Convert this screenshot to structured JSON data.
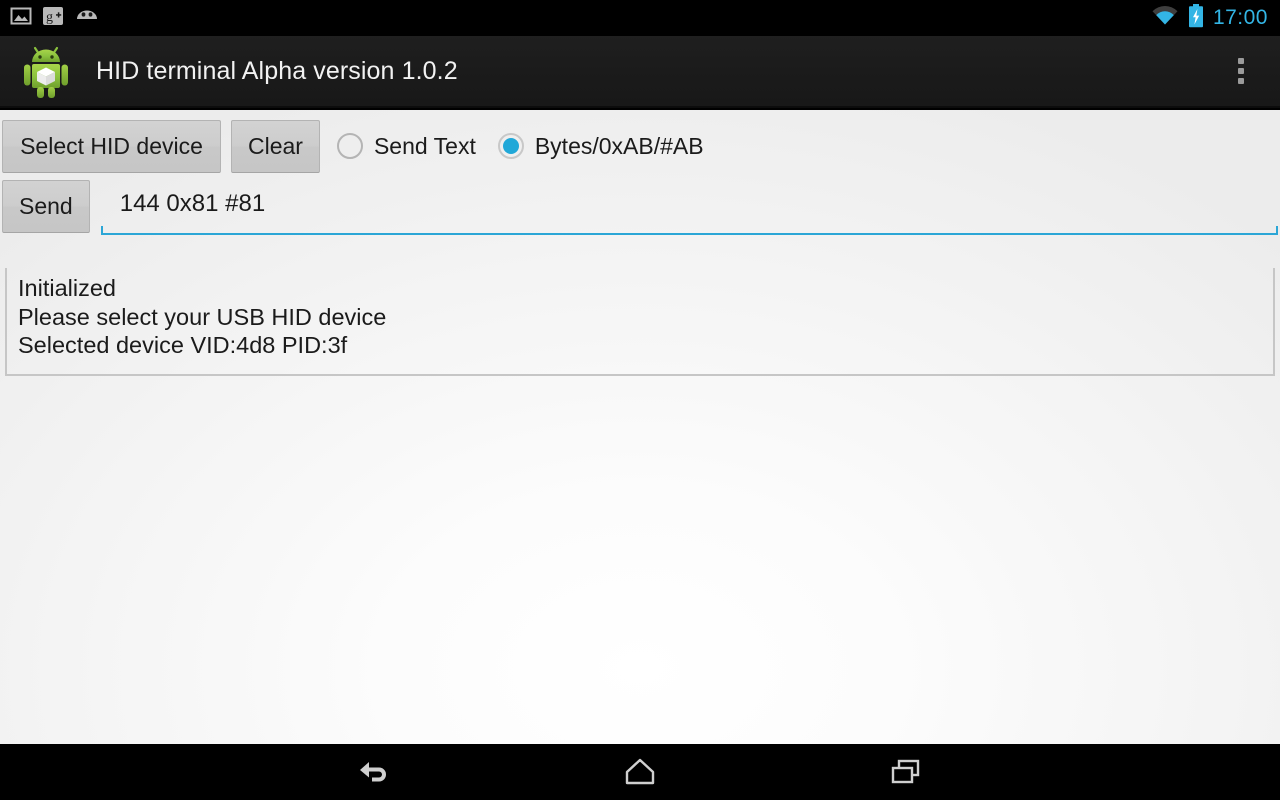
{
  "status_bar": {
    "notifications": [
      {
        "name": "gallery-icon",
        "label": "Gallery"
      },
      {
        "name": "google-plus-icon",
        "label": "Google+"
      },
      {
        "name": "android-head-icon",
        "label": "Android"
      }
    ],
    "wifi_icon": "wifi-icon",
    "battery_icon": "battery-charging-icon",
    "time": "17:00",
    "accent_color": "#33b5e5"
  },
  "action_bar": {
    "app_icon": "android-robot-icon",
    "title": "HID terminal Alpha version 1.0.2",
    "overflow_icon": "overflow-menu-icon",
    "background_color": "#1b1b1b",
    "title_color": "#f2f2f2"
  },
  "toolbar": {
    "select_device_label": "Select HID device",
    "clear_label": "Clear",
    "send_label": "Send"
  },
  "send_mode": {
    "options": [
      {
        "label": "Send Text",
        "selected": false
      },
      {
        "label": "Bytes/0xAB/#AB",
        "selected": true
      }
    ],
    "selected_color": "#21a8d8"
  },
  "input": {
    "value": "144 0x81 #81",
    "placeholder": "",
    "underline_color": "#2ba6d6"
  },
  "log": {
    "lines": [
      "Initialized",
      "Please select your USB HID device",
      "Selected device VID:4d8 PID:3f"
    ]
  },
  "nav_bar": {
    "buttons": [
      {
        "name": "back-button",
        "label": "Back"
      },
      {
        "name": "home-button",
        "label": "Home"
      },
      {
        "name": "recents-button",
        "label": "Recents"
      }
    ],
    "icon_color": "#cfcfcf"
  }
}
